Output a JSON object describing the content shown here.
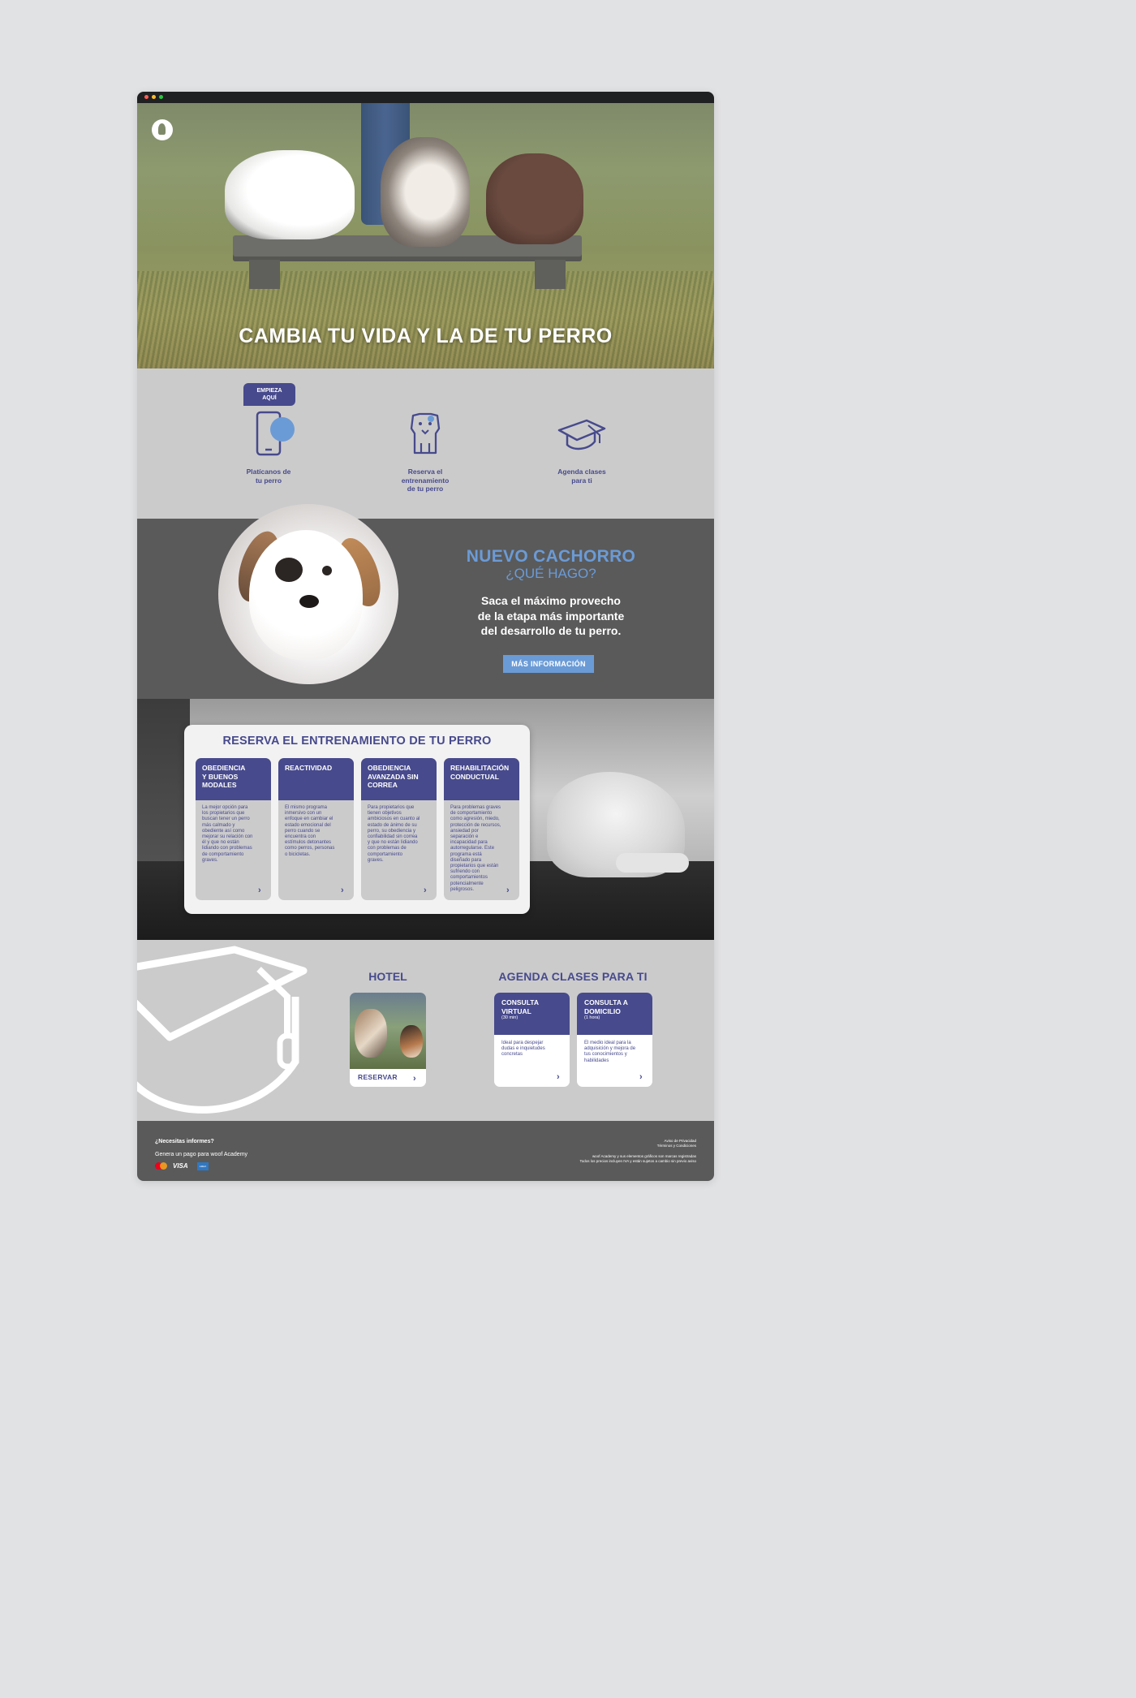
{
  "hero": {
    "title": "CAMBIA TU VIDA Y LA DE TU PERRO"
  },
  "steps": {
    "bubble": "EMPIEZA\nAQUÍ",
    "items": [
      {
        "label": "Platícanos de\ntu perro",
        "icon": "smartphone-chat-icon"
      },
      {
        "label": "Reserva el\nentrenamiento\nde tu perro",
        "icon": "dog-icon"
      },
      {
        "label": "Agenda clases\npara ti",
        "icon": "graduation-cap-icon"
      }
    ]
  },
  "puppy": {
    "title": "NUEVO CACHORRO",
    "subtitle": "¿QUÉ HAGO?",
    "description": "Saca el máximo provecho\nde la etapa más importante\ndel desarrollo de tu perro.",
    "button": "MÁS INFORMACIÓN"
  },
  "training": {
    "title": "RESERVA EL ENTRENAMIENTO DE TU PERRO",
    "cards": [
      {
        "name": "OBEDIENCIA\nY BUENOS\nMODALES",
        "text": "La mejor opción para\nlos propietarios que\nbuscan tener un perro\nmás calmado y\nobediente así como\nmejorar su relación con\nél y que no están\nlidiando con problemas\nde comportamiento\ngraves."
      },
      {
        "name": "REACTIVIDAD",
        "text": "El mismo programa\ninmersivo con un\nenfoque en cambiar el\nestado emocional del\nperro cuando se\nencuentra con\nestímulos detonantes\ncomo perros, personas\no bicicletas."
      },
      {
        "name": "OBEDIENCIA\nAVANZADA SIN\nCORREA",
        "text": "Para propietarios que\ntienen objetivos\nambiciosos en cuanto al\nestado de ánimo de su\nperro, su obediencia y\nconfiabilidad sin correa\ny que no están lidiando\ncon problemas de\ncomportamiento\ngraves."
      },
      {
        "name": "REHABILITACIÓN\nCONDUCTUAL",
        "text": "Para problemas graves\nde comportamiento\ncomo agresión, miedo,\nprotección de recursos,\nansiedad por\nseparación e\nincapacidad para\nautorregularse. Este\nprograma está\ndiseñado para\npropietarios que están\nsufriendo con\ncomportamientos\npotencialmente\npeligrosos."
      }
    ]
  },
  "hotel": {
    "title": "HOTEL",
    "button": "RESERVAR"
  },
  "classes": {
    "title": "AGENDA CLASES PARA TI",
    "cards": [
      {
        "name": "CONSULTA\nVIRTUAL",
        "duration": "(30 min)",
        "text": "Ideal para despejar\ndudas e inquietudes\nconcretas"
      },
      {
        "name": "CONSULTA A\nDOMICILIO",
        "duration": "(1 hora)",
        "text": "El medio ideal para la\nadquisición y mejora de\ntus conocimientos y\nhabilidades"
      }
    ]
  },
  "footer": {
    "question": "¿Necesitas informes?",
    "payment": "Genera un pago para woof Academy",
    "visa": "VISA",
    "amex": "AMEX",
    "links": "Aviso de Privacidad\nTérminos y Condiciones",
    "legal": "woof Academy y sus elementos gráficos son marcas registradas\nTodos los precios incluyen IVA y están sujetos a cambio sin previo aviso"
  },
  "colors": {
    "brand": "#474a8c",
    "accent": "#6b9bd6",
    "dark": "#5a5a5b",
    "light": "#cbcbcc"
  }
}
